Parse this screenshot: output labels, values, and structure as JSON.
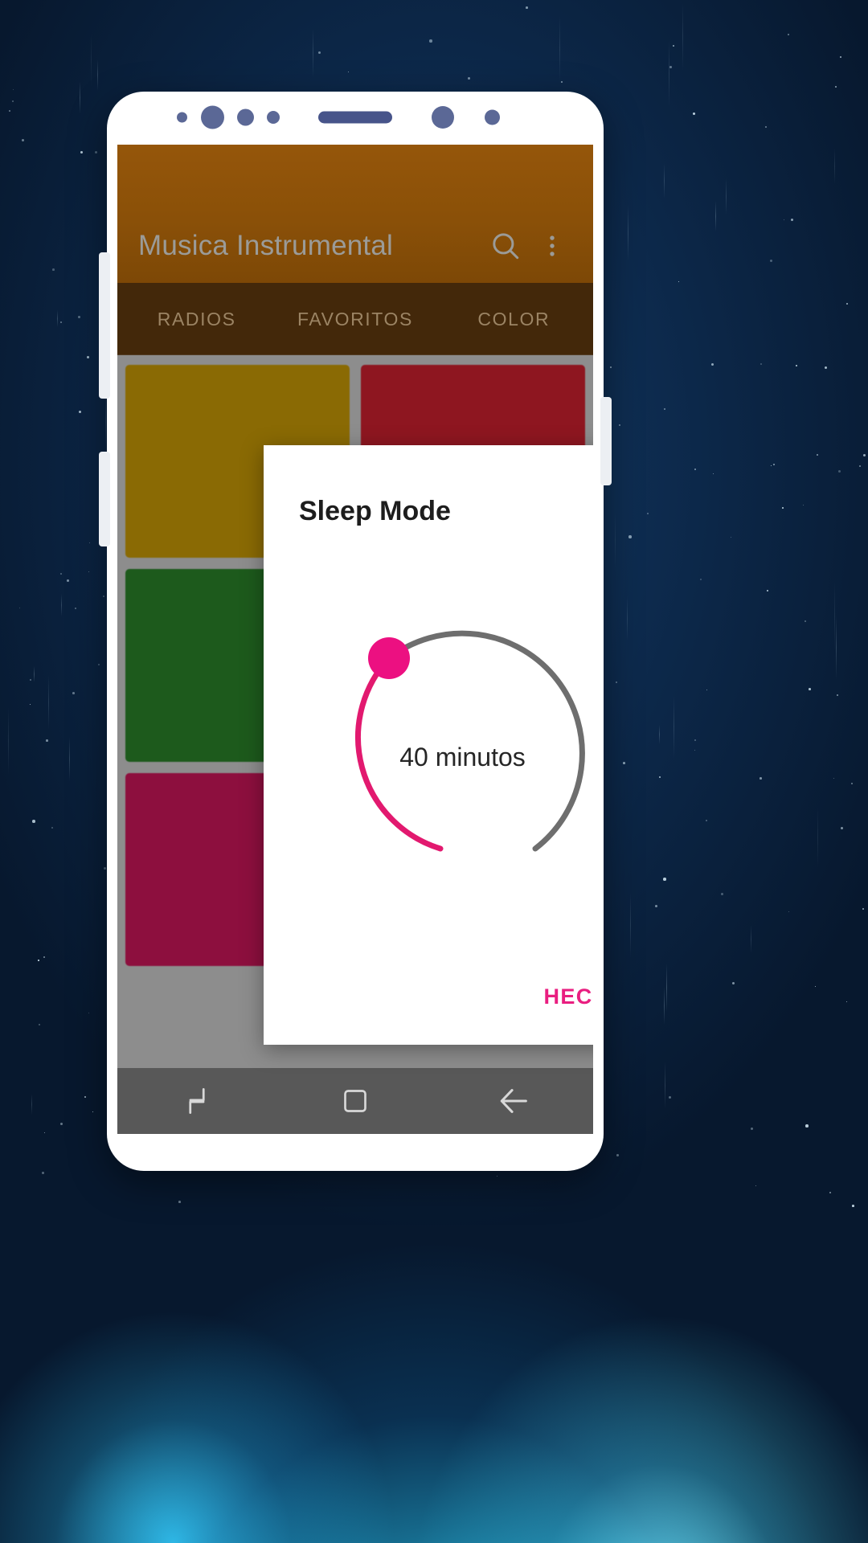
{
  "app": {
    "title": "Musica Instrumental",
    "toolbar_color": "#8a5008",
    "tabbar_color": "#43280a",
    "icons": {
      "search": "search-icon",
      "overflow": "overflow-menu-icon"
    },
    "tabs": [
      {
        "label": "RADIOS"
      },
      {
        "label": "FAVORITOS"
      },
      {
        "label": "COLOR"
      }
    ],
    "tiles": [
      {
        "color": "#8a6a04"
      },
      {
        "color": "#8e1620"
      },
      {
        "color": "#1d5a1c"
      },
      {
        "color": "#14556e"
      },
      {
        "color": "#8d0f3e"
      },
      {
        "color": "#8d7a06"
      }
    ]
  },
  "dialog": {
    "title": "Sleep Mode",
    "value_label": "40 minutos",
    "done_label": "HECHO",
    "accent_color": "#e91e80",
    "track_color": "#6e6e6e",
    "timer": {
      "minutes": 40,
      "max_minutes": 60,
      "knob_angle_deg": 240,
      "progress_fraction": 0.67
    }
  },
  "navbar": {
    "color": "#585858",
    "buttons": [
      {
        "icon": "recents-icon"
      },
      {
        "icon": "home-square-icon"
      },
      {
        "icon": "back-arrow-icon"
      }
    ]
  },
  "phone": {
    "sensor_dots": 6,
    "speaker": "earpiece-speaker"
  }
}
